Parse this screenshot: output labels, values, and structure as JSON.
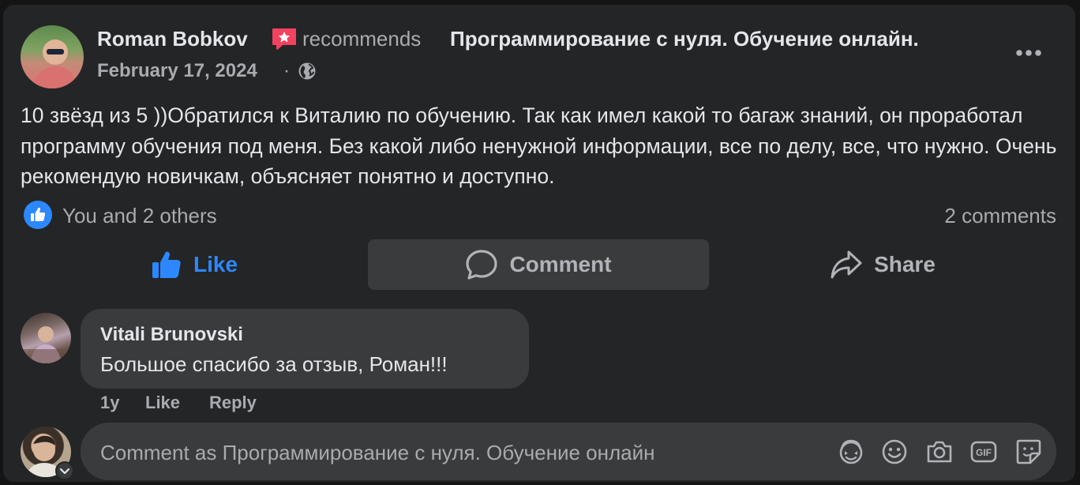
{
  "post": {
    "author": "Roman Bobkov",
    "recommends_text": "recommends",
    "page_name": "Программирование с нуля. Обучение онлайн.",
    "date": "February 17, 2024",
    "date_separator": "·",
    "audience_icon": "globe-icon",
    "menu_icon": "more-icon",
    "body": "10 звёзд из 5 ))Обратился к Виталию по обучению. Так как имел какой то багаж знаний, он проработал программу обучения под меня. Без какой либо ненужной информации, все по делу, все, что нужно. Очень рекомендую новичкам, объясняет понятно и доступно."
  },
  "reactions": {
    "text": "You and 2 others",
    "comments_count": "2 comments"
  },
  "actions": {
    "like": "Like",
    "comment": "Comment",
    "share": "Share"
  },
  "comment": {
    "author": "Vitali Brunovski",
    "text": "Большое спасибо за отзыв, Роман!!!",
    "time": "1y",
    "like": "Like",
    "reply": "Reply"
  },
  "composer": {
    "placeholder": "Comment as Программирование с нуля. Обучение онлайн",
    "tools": [
      "avatar-sticker-icon",
      "emoji-icon",
      "camera-icon",
      "gif-icon",
      "sticker-icon"
    ]
  },
  "colors": {
    "card": "#242526",
    "accent_blue": "#2d88ff",
    "text_primary": "#e4e6eb",
    "text_secondary": "#a8abaf",
    "recommend_badge": "#f3425f"
  }
}
